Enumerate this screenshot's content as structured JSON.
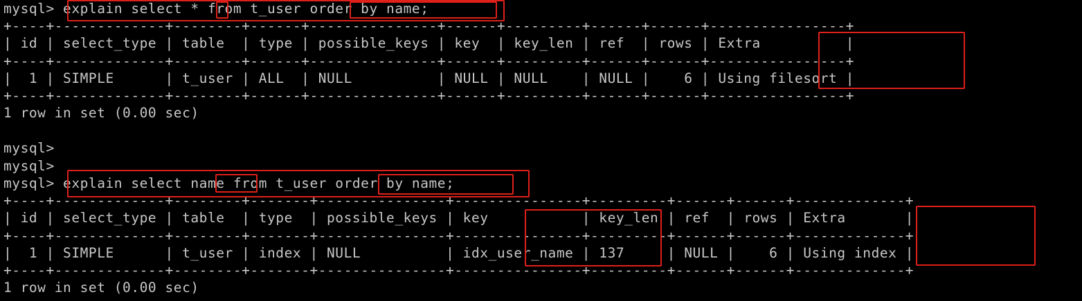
{
  "terminal": {
    "text_color": "#c8c8c8",
    "background": "#000000",
    "highlight_color": "#e0201a",
    "lines": [
      "mysql> explain select * from t_user order by name;",
      "+----+-------------+--------+------+---------------+------+---------+------+------+----------------+",
      "| id | select_type | table  | type | possible_keys | key  | key_len | ref  | rows | Extra          |",
      "+----+-------------+--------+------+---------------+------+---------+------+------+----------------+",
      "|  1 | SIMPLE      | t_user | ALL  | NULL          | NULL | NULL    | NULL |    6 | Using filesort |",
      "+----+-------------+--------+------+---------------+------+---------+------+------+----------------+",
      "1 row in set (0.00 sec)",
      "",
      "mysql>",
      "mysql>",
      "mysql> explain select name from t_user order by name;",
      "+----+-------------+--------+-------+---------------+---------------+---------+------+------+-------------+",
      "| id | select_type | table  | type  | possible_keys | key           | key_len | ref  | rows | Extra       |",
      "+----+-------------+--------+-------+---------------+---------------+---------+------+------+-------------+",
      "|  1 | SIMPLE      | t_user | index | NULL          | idx_user_name | 137     | NULL |    6 | Using index |",
      "+----+-------------+--------+-------+---------------+---------------+---------+------+------+-------------+",
      "1 row in set (0.00 sec)"
    ]
  }
}
